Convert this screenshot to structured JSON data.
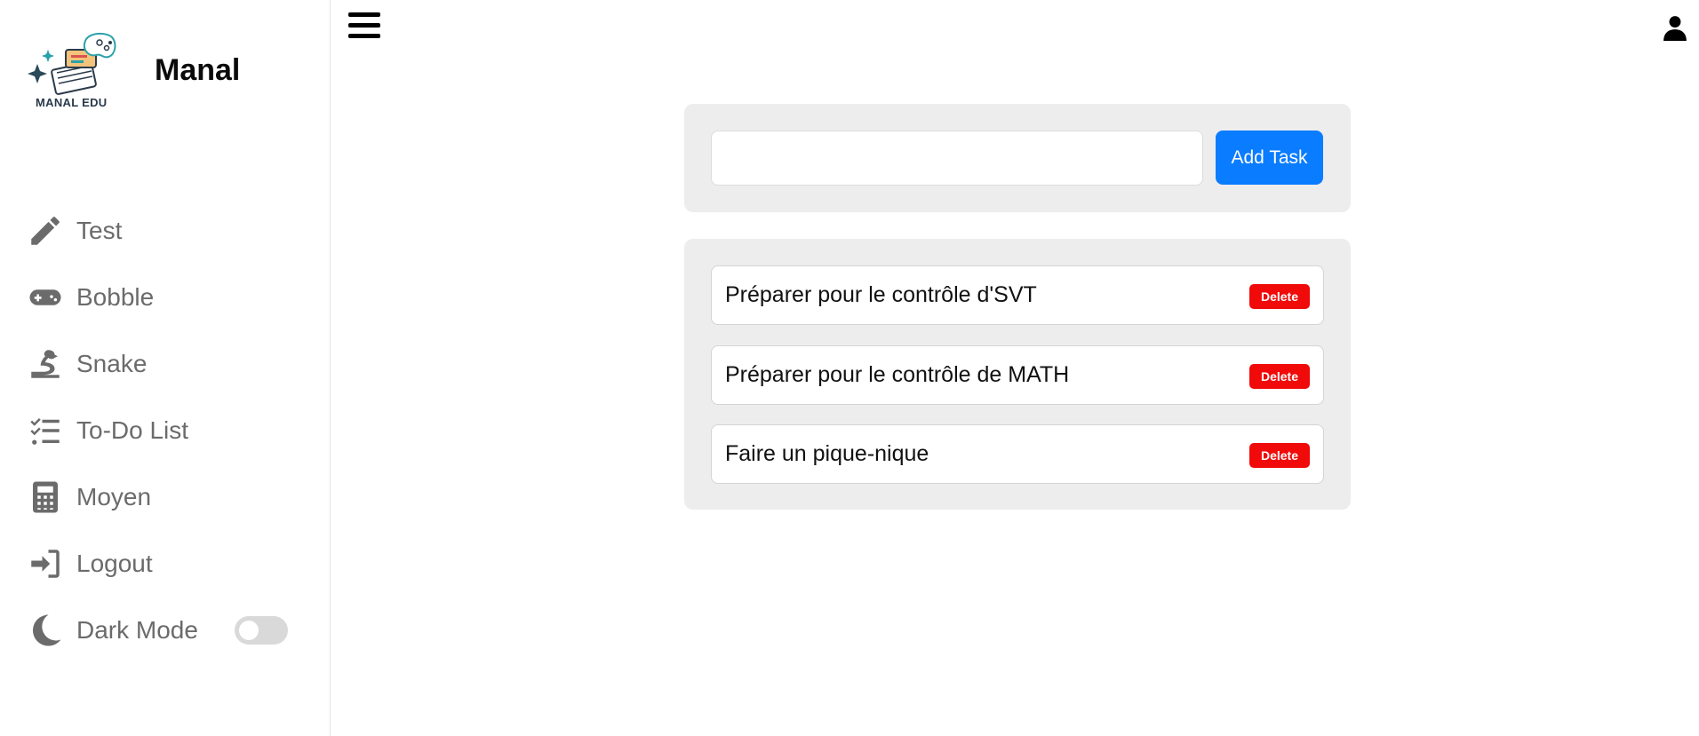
{
  "brand": {
    "logo_caption": "MANAL EDU",
    "name": "Manal"
  },
  "nav": {
    "items": [
      {
        "label": "Test",
        "icon": "pencil-icon"
      },
      {
        "label": "Bobble",
        "icon": "gamepad-icon"
      },
      {
        "label": "Snake",
        "icon": "snake-icon"
      },
      {
        "label": "To-Do List",
        "icon": "checklist-icon"
      },
      {
        "label": "Moyen",
        "icon": "calculator-icon"
      },
      {
        "label": "Logout",
        "icon": "logout-icon"
      },
      {
        "label": "Dark Mode",
        "icon": "moon-icon",
        "toggle_on": false
      }
    ]
  },
  "todo": {
    "input_value": "",
    "add_label": "Add Task",
    "tasks": [
      {
        "text": "Préparer pour le contrôle d'SVT",
        "delete_label": "Delete"
      },
      {
        "text": "Préparer pour le contrôle de MATH",
        "delete_label": "Delete"
      },
      {
        "text": "Faire un pique-nique",
        "delete_label": "Delete"
      }
    ]
  },
  "colors": {
    "accent": "#0a7cff",
    "danger": "#f00a0a",
    "panel": "#ededed",
    "nav_text": "#6b6b6b"
  }
}
